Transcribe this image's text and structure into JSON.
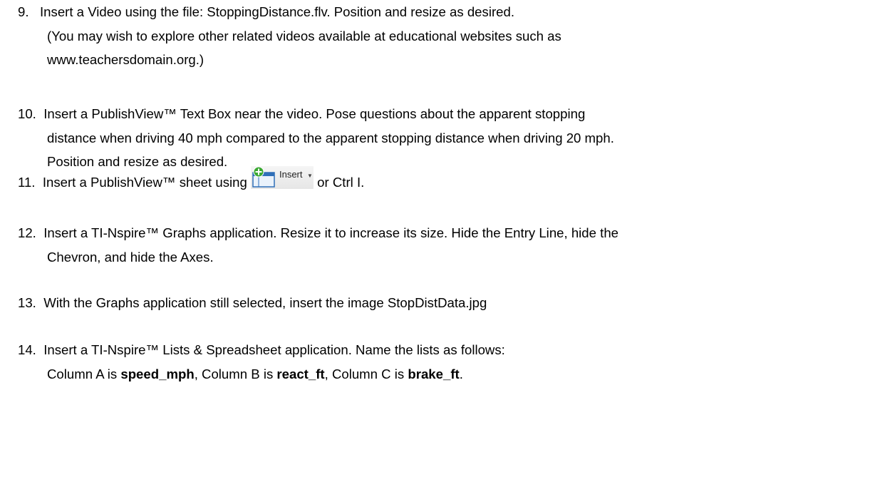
{
  "steps": [
    {
      "number": "9.",
      "lines": [
        "Insert a Video using the file: StoppingDistance.flv. Position and resize as desired.",
        "(You may wish to explore other related videos available at educational websites such as",
        "www.teachersdomain.org.)"
      ]
    },
    {
      "number": "10.",
      "lines": [
        "Insert a PublishView™ Text Box near the video. Pose questions about the apparent stopping",
        "distance when driving 40 mph compared to the apparent stopping distance when driving 20 mph.",
        "Position and resize as desired."
      ]
    },
    {
      "number": "11.",
      "text_before": "Insert a PublishView™ sheet using",
      "button_label": "Insert",
      "button_icon": "insert-sheet-icon",
      "text_after": "or Ctrl I."
    },
    {
      "number": "12.",
      "lines": [
        "Insert a TI-Nspire™ Graphs application. Resize it to increase its size. Hide the Entry Line, hide the",
        "Chevron, and hide the Axes."
      ]
    },
    {
      "number": "13.",
      "lines": [
        "With the Graphs application still selected, insert the image StopDistData.jpg"
      ]
    },
    {
      "number": "14.",
      "line1": "Insert a TI-Nspire™ Lists & Spreadsheet application. Name the lists as follows:",
      "line2_parts": [
        "Column A is ",
        "speed_mph",
        ", Column B is ",
        "react_ft",
        ", Column C is ",
        "brake_ft",
        "."
      ]
    }
  ],
  "colors": {
    "text": "#000000",
    "background": "#ffffff",
    "icon_green": "#3aa832",
    "icon_blue": "#2f6fb8"
  }
}
